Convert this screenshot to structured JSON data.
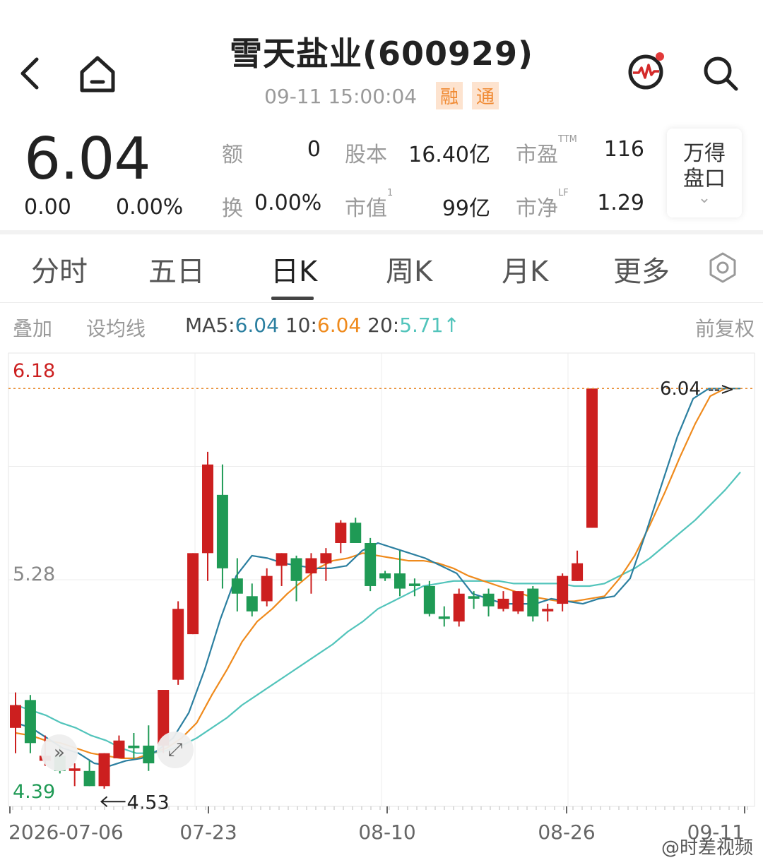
{
  "header": {
    "title": "雪天盐业(600929)",
    "datetime": "09-11 15:00:04",
    "badges": [
      "融",
      "通"
    ],
    "icons": [
      "back-icon",
      "home-icon",
      "pulse-icon",
      "search-icon"
    ]
  },
  "quote": {
    "price": "6.04",
    "change": "0.00",
    "change_pct": "0.00%",
    "stats": {
      "amount_label": "额",
      "amount": "0",
      "share_cap_label": "股本",
      "share_cap": "16.40亿",
      "pe_label": "市盈",
      "pe_sup": "TTM",
      "pe": "116",
      "turnover_label": "换",
      "turnover": "0.00%",
      "mcap_label": "市值",
      "mcap_sup": "1",
      "mcap": "99亿",
      "pb_label": "市净",
      "pb_sup": "LF",
      "pb": "1.29"
    },
    "wind_button": {
      "line1": "万得",
      "line2": "盘口"
    }
  },
  "tabs": [
    {
      "label": "分时",
      "active": false
    },
    {
      "label": "五日",
      "active": false
    },
    {
      "label": "日K",
      "active": true
    },
    {
      "label": "周K",
      "active": false
    },
    {
      "label": "月K",
      "active": false
    },
    {
      "label": "更多",
      "active": false
    }
  ],
  "ma_row": {
    "overlay": "叠加",
    "set_ma": "设均线",
    "ma5_label": "MA5:",
    "ma5": "6.04",
    "ma10_label": "10:",
    "ma10": "6.04",
    "ma20_label": "20:",
    "ma20": "5.71",
    "arrow": "↑",
    "adjust": "前复权"
  },
  "chart_data": {
    "type": "candlestick",
    "y_top_label": "6.18",
    "y_mid_label": "5.28",
    "y_bottom_label": "4.39",
    "ylim": [
      4.39,
      6.18
    ],
    "x_labels": [
      "2026-07-06",
      "07-23",
      "08-10",
      "08-26",
      "09-11"
    ],
    "last_price_label": "6.04",
    "min_marker_label": "4.53",
    "up_color": "#cc1f1f",
    "down_color": "#1f9a55",
    "ma5_color": "#2b7fa0",
    "ma10_color": "#ef8a1c",
    "ma20_color": "#52c4bb",
    "grid": true,
    "candles": [
      {
        "o": 4.7,
        "h": 4.84,
        "l": 4.6,
        "c": 4.79
      },
      {
        "o": 4.81,
        "h": 4.83,
        "l": 4.6,
        "c": 4.64
      },
      {
        "o": 4.57,
        "h": 4.67,
        "l": 4.55,
        "c": 4.59
      },
      {
        "o": 4.59,
        "h": 4.63,
        "l": 4.52,
        "c": 4.53
      },
      {
        "o": 4.53,
        "h": 4.56,
        "l": 4.47,
        "c": 4.54
      },
      {
        "o": 4.53,
        "h": 4.57,
        "l": 4.47,
        "c": 4.47
      },
      {
        "o": 4.47,
        "h": 4.6,
        "l": 4.46,
        "c": 4.6
      },
      {
        "o": 4.58,
        "h": 4.67,
        "l": 4.58,
        "c": 4.65
      },
      {
        "o": 4.63,
        "h": 4.68,
        "l": 4.58,
        "c": 4.62
      },
      {
        "o": 4.63,
        "h": 4.71,
        "l": 4.53,
        "c": 4.56
      },
      {
        "o": 4.63,
        "h": 4.85,
        "l": 4.6,
        "c": 4.85
      },
      {
        "o": 4.89,
        "h": 5.2,
        "l": 4.87,
        "c": 5.17
      },
      {
        "o": 5.07,
        "h": 5.39,
        "l": 5.07,
        "c": 5.39
      },
      {
        "o": 5.39,
        "h": 5.79,
        "l": 5.28,
        "c": 5.74
      },
      {
        "o": 5.62,
        "h": 5.74,
        "l": 5.25,
        "c": 5.33
      },
      {
        "o": 5.29,
        "h": 5.37,
        "l": 5.16,
        "c": 5.23
      },
      {
        "o": 5.22,
        "h": 5.27,
        "l": 5.14,
        "c": 5.16
      },
      {
        "o": 5.2,
        "h": 5.33,
        "l": 5.18,
        "c": 5.3
      },
      {
        "o": 5.34,
        "h": 5.39,
        "l": 5.26,
        "c": 5.39
      },
      {
        "o": 5.37,
        "h": 5.38,
        "l": 5.2,
        "c": 5.28
      },
      {
        "o": 5.31,
        "h": 5.39,
        "l": 5.23,
        "c": 5.37
      },
      {
        "o": 5.35,
        "h": 5.41,
        "l": 5.28,
        "c": 5.39
      },
      {
        "o": 5.43,
        "h": 5.52,
        "l": 5.39,
        "c": 5.51
      },
      {
        "o": 5.51,
        "h": 5.53,
        "l": 5.44,
        "c": 5.43
      },
      {
        "o": 5.43,
        "h": 5.45,
        "l": 5.24,
        "c": 5.26
      },
      {
        "o": 5.31,
        "h": 5.32,
        "l": 5.28,
        "c": 5.29
      },
      {
        "o": 5.31,
        "h": 5.4,
        "l": 5.22,
        "c": 5.25
      },
      {
        "o": 5.27,
        "h": 5.29,
        "l": 5.22,
        "c": 5.26
      },
      {
        "o": 5.26,
        "h": 5.28,
        "l": 5.14,
        "c": 5.15
      },
      {
        "o": 5.14,
        "h": 5.18,
        "l": 5.1,
        "c": 5.13
      },
      {
        "o": 5.12,
        "h": 5.25,
        "l": 5.1,
        "c": 5.23
      },
      {
        "o": 5.22,
        "h": 5.24,
        "l": 5.17,
        "c": 5.21
      },
      {
        "o": 5.23,
        "h": 5.25,
        "l": 5.14,
        "c": 5.18
      },
      {
        "o": 5.17,
        "h": 5.24,
        "l": 5.16,
        "c": 5.21
      },
      {
        "o": 5.16,
        "h": 5.24,
        "l": 5.15,
        "c": 5.24
      },
      {
        "o": 5.25,
        "h": 5.26,
        "l": 5.12,
        "c": 5.14
      },
      {
        "o": 5.16,
        "h": 5.19,
        "l": 5.12,
        "c": 5.17
      },
      {
        "o": 5.19,
        "h": 5.31,
        "l": 5.16,
        "c": 5.3
      },
      {
        "o": 5.28,
        "h": 5.4,
        "l": 5.28,
        "c": 5.35
      },
      {
        "o": 5.49,
        "h": 6.04,
        "l": 5.49,
        "c": 6.04
      }
    ],
    "ma5": [
      4.72,
      4.7,
      4.66,
      4.62,
      4.6,
      4.56,
      4.55,
      4.57,
      4.58,
      4.61,
      4.66,
      4.76,
      4.93,
      5.13,
      5.3,
      5.38,
      5.37,
      5.35,
      5.34,
      5.33,
      5.33,
      5.34,
      5.4,
      5.43,
      5.41,
      5.39,
      5.37,
      5.34,
      5.31,
      5.23,
      5.21,
      5.19,
      5.19,
      5.19,
      5.21,
      5.2,
      5.19,
      5.21,
      5.22,
      5.29,
      5.47,
      5.66,
      5.85,
      6.0,
      6.04,
      6.04,
      6.04
    ],
    "ma10": [
      4.68,
      4.67,
      4.65,
      4.64,
      4.62,
      4.6,
      4.59,
      4.58,
      4.58,
      4.6,
      4.62,
      4.66,
      4.72,
      4.83,
      4.93,
      5.04,
      5.12,
      5.17,
      5.23,
      5.28,
      5.33,
      5.36,
      5.37,
      5.39,
      5.38,
      5.37,
      5.36,
      5.36,
      5.35,
      5.33,
      5.3,
      5.28,
      5.26,
      5.24,
      5.22,
      5.21,
      5.2,
      5.2,
      5.21,
      5.22,
      5.29,
      5.38,
      5.5,
      5.63,
      5.77,
      5.9,
      6.01,
      6.04,
      6.04
    ],
    "ma20": [
      4.79,
      4.77,
      4.75,
      4.72,
      4.7,
      4.67,
      4.65,
      4.62,
      4.6,
      4.6,
      4.61,
      4.63,
      4.66,
      4.7,
      4.74,
      4.79,
      4.83,
      4.87,
      4.91,
      4.95,
      4.99,
      5.03,
      5.08,
      5.12,
      5.17,
      5.2,
      5.23,
      5.26,
      5.27,
      5.28,
      5.28,
      5.28,
      5.28,
      5.27,
      5.27,
      5.27,
      5.27,
      5.26,
      5.26,
      5.27,
      5.3,
      5.33,
      5.37,
      5.42,
      5.47,
      5.52,
      5.58,
      5.64,
      5.71
    ]
  },
  "chart_controls": {
    "expand_left": "»",
    "fullscreen": "⤢"
  },
  "watermark": "@时差视频"
}
